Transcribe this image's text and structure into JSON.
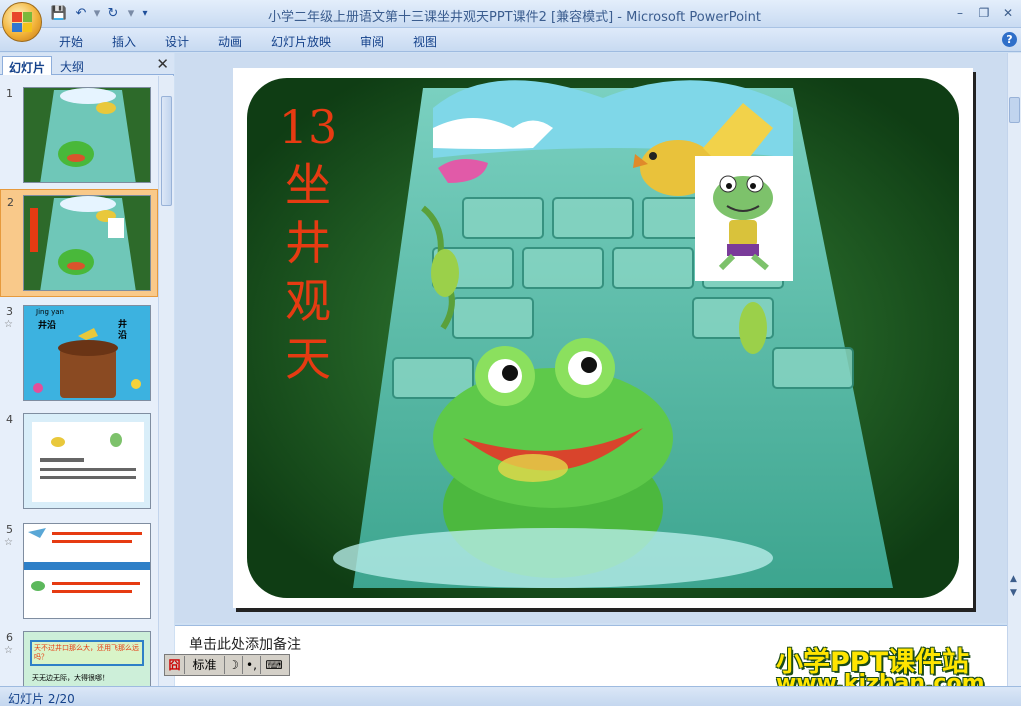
{
  "window": {
    "title": "小学二年级上册语文第十三课坐井观天PPT课件2 [兼容模式] - Microsoft PowerPoint",
    "minimize_glyph": "–",
    "restore_glyph": "❐",
    "close_glyph": "✕"
  },
  "qat": {
    "save_icon": "save-icon",
    "undo_icon": "undo-icon",
    "redo_icon": "redo-icon",
    "customize_icon": "qat-dropdown-icon"
  },
  "ribbon": {
    "tabs": [
      {
        "label": "开始"
      },
      {
        "label": "插入"
      },
      {
        "label": "设计"
      },
      {
        "label": "动画"
      },
      {
        "label": "幻灯片放映"
      },
      {
        "label": "审阅"
      },
      {
        "label": "视图"
      }
    ],
    "help_glyph": "?"
  },
  "left_panel": {
    "tab_slides": "幻灯片",
    "tab_outline": "大纲",
    "close_glyph": "✕",
    "thumbnails": [
      {
        "num": "1",
        "star": ""
      },
      {
        "num": "2",
        "star": ""
      },
      {
        "num": "3",
        "star": "☆",
        "pinyin": "Jing yan",
        "label_left": "井沿",
        "label_right": "井沿"
      },
      {
        "num": "4",
        "star": ""
      },
      {
        "num": "5",
        "star": "☆"
      },
      {
        "num": "6",
        "star": "☆",
        "text1": "天不过井口那么大，还用飞那么远吗？",
        "text2": "天无边无际，大得很哪！"
      }
    ]
  },
  "slide": {
    "number_text": "13",
    "title_chars": [
      "坐",
      "井",
      "观",
      "天"
    ]
  },
  "notes": {
    "placeholder": "单击此处添加备注"
  },
  "ime": {
    "mode": "标准",
    "moon": "☽",
    "punct": "•,",
    "kbd": "⌨"
  },
  "watermark": {
    "line1": "小学PPT课件站",
    "line2": "www.kjzhan.com"
  },
  "status": {
    "slide_indicator": "幻灯片 2/20"
  }
}
